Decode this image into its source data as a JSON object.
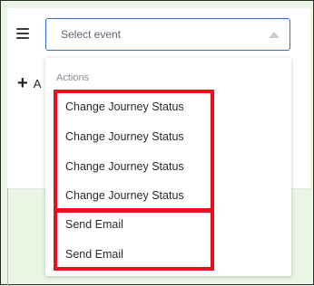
{
  "header": {
    "menu_icon": "hamburger-menu-icon",
    "add_icon": "plus-icon",
    "add_label_partial": "A"
  },
  "select": {
    "placeholder": "Select event",
    "caret_icon": "caret-up-icon"
  },
  "dropdown": {
    "group_label": "Actions",
    "options": [
      "Change Journey Status",
      "Change Journey Status",
      "Change Journey Status",
      "Change Journey Status",
      "Send Email",
      "Send Email"
    ]
  },
  "colors": {
    "highlight": "#e8111c",
    "select_border": "#2f6fc0",
    "background": "#eaf5e3"
  }
}
